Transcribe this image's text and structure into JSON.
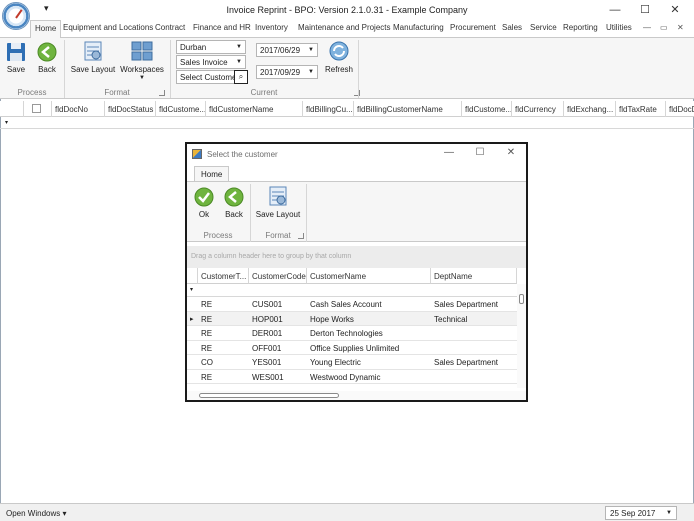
{
  "window": {
    "title": "Invoice Reprint - BPO: Version 2.1.0.31 - Example Company",
    "qat_glyph": "▾",
    "minimize": "—",
    "maximize": "☐",
    "close": "✕"
  },
  "ribbon": {
    "tabs": [
      "Home",
      "Equipment and Locations",
      "Contract",
      "Finance and HR",
      "Inventory",
      "Maintenance and Projects",
      "Manufacturing",
      "Procurement",
      "Sales",
      "Service",
      "Reporting",
      "Utilities"
    ],
    "tab_controls": [
      "—",
      "▭",
      "✕"
    ],
    "process": {
      "label": "Process",
      "save": "Save",
      "back": "Back"
    },
    "format": {
      "label": "Format",
      "save_layout": "Save Layout",
      "workspaces": "Workspaces"
    },
    "current": {
      "label": "Current",
      "site": "Durban",
      "doc_type": "Sales Invoice",
      "customer": "Select Customer",
      "date_from": "2017/06/29",
      "date_to": "2017/09/29",
      "refresh": "Refresh"
    }
  },
  "grid": {
    "columns": [
      "fldDocNo",
      "fldDocStatus",
      "fldCustome...",
      "fldCustomerName",
      "fldBillingCu...",
      "fldBillingCustomerName",
      "fldCustome...",
      "fldCurrency",
      "fldExchang...",
      "fldTaxRate",
      "fldDocDe"
    ],
    "filter_glyph": "▾"
  },
  "status": {
    "open_windows": "Open Windows ▾",
    "date": "25 Sep 2017"
  },
  "dialog": {
    "title": "Select the customer",
    "tab": "Home",
    "process": {
      "label": "Process",
      "ok": "Ok",
      "back": "Back"
    },
    "format": {
      "label": "Format",
      "save_layout": "Save Layout"
    },
    "groupby_hint": "Drag a column header here to group by that column",
    "columns": [
      "CustomerT...",
      "CustomerCode",
      "CustomerName",
      "DeptName"
    ],
    "filter_glyph": "▾",
    "row_indicator": "▸",
    "rows": [
      {
        "type": "RE",
        "code": "CUS001",
        "name": "Cash Sales Account",
        "dept": "Sales Department"
      },
      {
        "type": "RE",
        "code": "HOP001",
        "name": "Hope Works",
        "dept": "Technical"
      },
      {
        "type": "RE",
        "code": "DER001",
        "name": "Derton Technologies",
        "dept": ""
      },
      {
        "type": "RE",
        "code": "OFF001",
        "name": "Office Supplies Unlimited",
        "dept": ""
      },
      {
        "type": "CO",
        "code": "YES001",
        "name": "Young Electric",
        "dept": "Sales Department"
      },
      {
        "type": "RE",
        "code": "WES001",
        "name": "Westwood Dynamic",
        "dept": ""
      }
    ]
  }
}
